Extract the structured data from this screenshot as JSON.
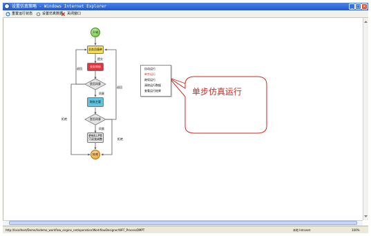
{
  "window": {
    "title": "设置仿真策略 - Windows Internet Explorer",
    "minimize": "_",
    "maximize": "□",
    "close": "×"
  },
  "toolbar": {
    "items": [
      {
        "label": "重置运行状态",
        "icon": "refresh-icon"
      },
      {
        "label": "设置仿真数据",
        "icon": "settings-icon"
      },
      {
        "label": "关闭窗口",
        "icon": "close-icon"
      }
    ]
  },
  "flow": {
    "start": "开始",
    "step1": "业务员填单",
    "submit_label": "提交",
    "step2": "业务审核",
    "decision1": "是否同意",
    "agree1": "同意",
    "step3": "财务主管",
    "decision2": "是否同意",
    "agree2": "同意",
    "step4": "更新ILLP等\n只读我调整",
    "end": "结束",
    "back_left": "退回",
    "back_right": "退回",
    "reject_left": "拒绝",
    "reject_right": "拒绝"
  },
  "context_menu": {
    "items": [
      "自动运行",
      "单步运行",
      "继续运行",
      "清除运行数据",
      "查看运行结果"
    ]
  },
  "callout": {
    "text": "单步仿真运行"
  },
  "statusbar": {
    "url": "http://localhost/Demo/lisdemo_workflow_engine_net/operation/WorkflowDesigner/WFF_ProcessDMPT",
    "zone": "本地 Intranet",
    "zoom": "100%"
  },
  "colors": {
    "start": "#7ed957",
    "end": "#f5a623",
    "step1": "#f6de5b",
    "step2": "#e8313c",
    "step3": "#5ec4e0",
    "step4": "#e6e6e6",
    "callout_border": "#d1261d"
  }
}
